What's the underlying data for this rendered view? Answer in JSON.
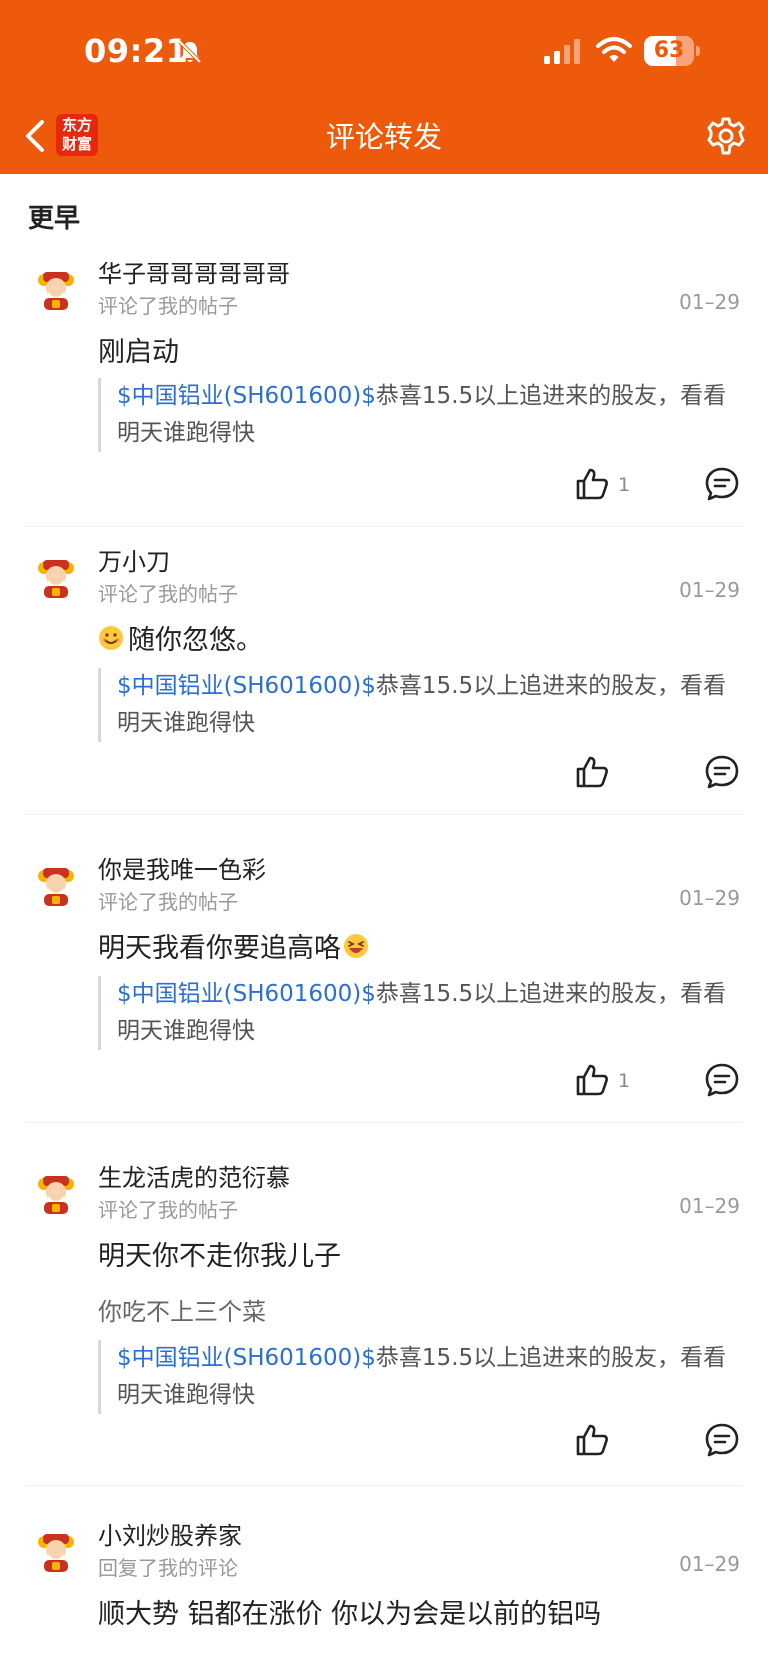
{
  "status": {
    "time": "09:21",
    "battery": "63",
    "battery_level": 63
  },
  "header": {
    "title": "评论转发",
    "logo_line1": "东方",
    "logo_line2": "财富"
  },
  "section": {
    "title": "更早"
  },
  "notifications": [
    {
      "user": "华子哥哥哥哥哥哥",
      "action": "评论了我的帖子",
      "date": "01–29",
      "comment": "刚启动",
      "comment_emoji": "",
      "reply": "",
      "quote_stock": "$中国铝业(SH601600)$",
      "quote_text": "恭喜15.5以上追进来的股友，看看明天谁跑得快",
      "likes": "1"
    },
    {
      "user": "万小刀",
      "action": "评论了我的帖子",
      "date": "01–29",
      "comment": "随你忽悠。",
      "comment_emoji": "smile-emoji-icon",
      "reply": "",
      "quote_stock": "$中国铝业(SH601600)$",
      "quote_text": "恭喜15.5以上追进来的股友，看看明天谁跑得快",
      "likes": ""
    },
    {
      "user": "你是我唯一色彩",
      "action": "评论了我的帖子",
      "date": "01–29",
      "comment": "明天我看你要追高咯",
      "comment_emoji": "laugh-emoji-icon",
      "reply": "",
      "quote_stock": "$中国铝业(SH601600)$",
      "quote_text": "恭喜15.5以上追进来的股友，看看明天谁跑得快",
      "likes": "1"
    },
    {
      "user": "生龙活虎的范衍慕",
      "action": "评论了我的帖子",
      "date": "01–29",
      "comment": "明天你不走你我儿子",
      "comment_emoji": "",
      "reply": "你吃不上三个菜",
      "quote_stock": "$中国铝业(SH601600)$",
      "quote_text": "恭喜15.5以上追进来的股友，看看明天谁跑得快",
      "likes": ""
    },
    {
      "user": "小刘炒股养家",
      "action": "回复了我的评论",
      "date": "01–29",
      "comment": "顺大势 铝都在涨价 你以为会是以前的铝吗",
      "comment_emoji": "",
      "reply": "",
      "quote_stock": "",
      "quote_text": "",
      "likes": ""
    }
  ]
}
